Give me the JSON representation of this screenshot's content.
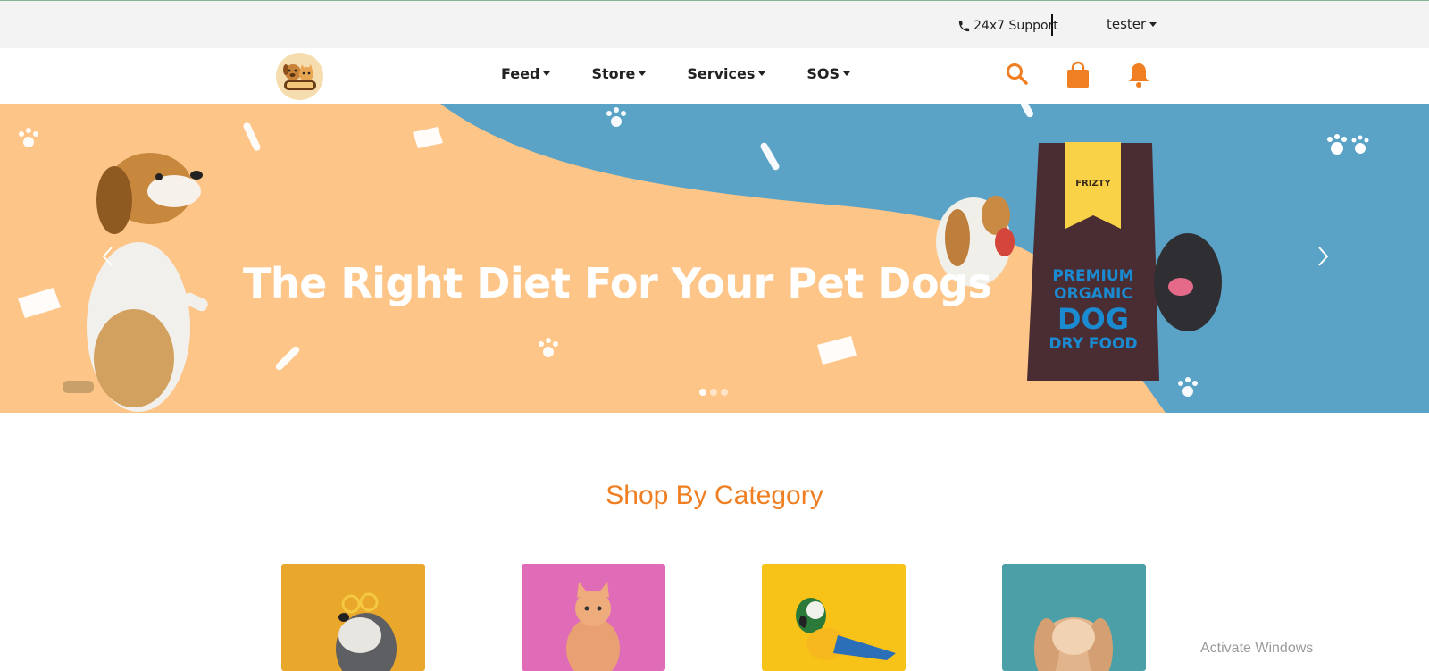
{
  "topbar": {
    "support_label": "24x7 Support",
    "user_name": "tester"
  },
  "nav": {
    "items": [
      {
        "label": "Feed"
      },
      {
        "label": "Store"
      },
      {
        "label": "Services"
      },
      {
        "label": "SOS"
      }
    ]
  },
  "hero": {
    "title": "The Right Diet For Your Pet Dogs",
    "bag": {
      "brand": "FRIZTY",
      "line1": "PREMIUM",
      "line2": "ORGANIC",
      "line3": "DOG",
      "line4": "DRY FOOD"
    },
    "slides_total": 3,
    "active_slide": 1
  },
  "shop": {
    "title": "Shop By Category",
    "categories": [
      {
        "icon": "dog-with-glasses",
        "color": "#e9a72c"
      },
      {
        "icon": "kitten",
        "color": "#e06cb8"
      },
      {
        "icon": "macaw-parrot",
        "color": "#f8c319"
      },
      {
        "icon": "rabbit",
        "color": "#4aa0a6"
      }
    ]
  },
  "watermark": "Activate Windows",
  "colors": {
    "accent": "#ef7f22",
    "hero_orange": "#fdc688",
    "hero_blue": "#5aa3c7",
    "topbar_bg": "#f3f3f3"
  }
}
